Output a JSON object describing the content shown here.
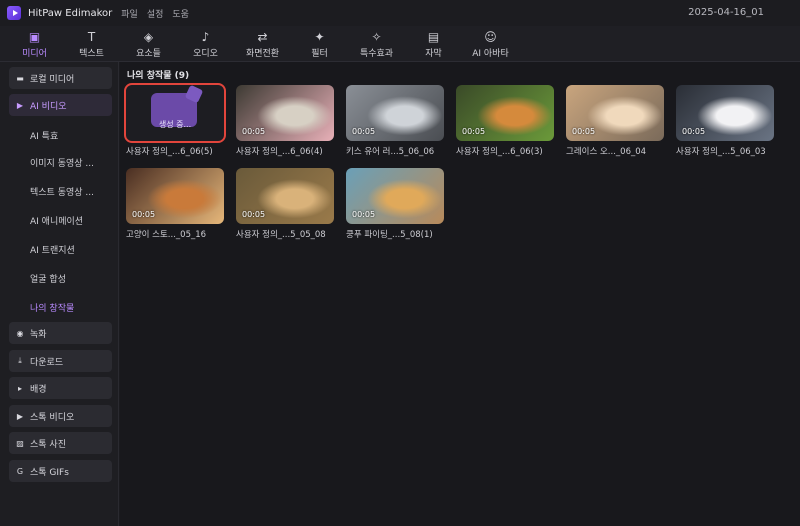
{
  "app": {
    "name": "HitPaw Edimakor",
    "menu": [
      "파일",
      "설정",
      "도움"
    ],
    "project_name": "2025-04-16_01",
    "accent": "#b98bff"
  },
  "toolbar": {
    "tabs": [
      {
        "label": "미디어",
        "icon": "media-icon",
        "glyph": "▣",
        "active": true
      },
      {
        "label": "텍스트",
        "icon": "text-icon",
        "glyph": "T",
        "active": false
      },
      {
        "label": "요소들",
        "icon": "elements-icon",
        "glyph": "◈",
        "active": false
      },
      {
        "label": "오디오",
        "icon": "audio-icon",
        "glyph": "♪",
        "active": false
      },
      {
        "label": "화면전환",
        "icon": "transition-icon",
        "glyph": "⇄",
        "active": false
      },
      {
        "label": "필터",
        "icon": "filter-icon",
        "glyph": "✦",
        "active": false
      },
      {
        "label": "특수효과",
        "icon": "effects-icon",
        "glyph": "✧",
        "active": false
      },
      {
        "label": "자막",
        "icon": "subtitle-icon",
        "glyph": "▤",
        "active": false
      },
      {
        "label": "AI 아바타",
        "icon": "avatar-icon",
        "glyph": "☺",
        "active": false
      }
    ]
  },
  "sidebar": {
    "items": [
      {
        "label": "로컬 미디어",
        "icon": "folder-icon",
        "glyph": "▬"
      },
      {
        "label": "AI 비디오",
        "icon": "ai-video-icon",
        "glyph": "▶",
        "selected": true
      },
      {
        "label": "녹화",
        "icon": "record-icon",
        "glyph": "◉"
      },
      {
        "label": "다운로드",
        "icon": "download-icon",
        "glyph": "⤓"
      },
      {
        "label": "배경",
        "icon": "expand-arrow-icon",
        "glyph": "▸"
      },
      {
        "label": "스톡 비디오",
        "icon": "stock-video-icon",
        "glyph": "▶"
      },
      {
        "label": "스톡 사진",
        "icon": "stock-photo-icon",
        "glyph": "▨"
      },
      {
        "label": "스톡 GIFs",
        "icon": "gif-icon",
        "glyph": "G"
      }
    ],
    "subitems": [
      {
        "label": "AI 특효",
        "selected": false
      },
      {
        "label": "이미지 동영상 ...",
        "selected": false
      },
      {
        "label": "텍스트 동영상 ...",
        "selected": false
      },
      {
        "label": "AI 애니메이션",
        "selected": false
      },
      {
        "label": "AI 트랜지션",
        "selected": false
      },
      {
        "label": "얼굴 합성",
        "selected": false
      },
      {
        "label": "나의 창작물",
        "selected": true
      }
    ]
  },
  "content": {
    "title": "나의 창작물 (9)",
    "items": [
      {
        "caption": "사용자 정의_...6_06(5)",
        "duration": "",
        "status": "생성 중...",
        "generating": true,
        "selected": true
      },
      {
        "caption": "사용자 정의_...6_06(4)",
        "duration": "00:05",
        "palette": [
          "#3d3a33",
          "#d7d0c4",
          "#e8b0b8"
        ]
      },
      {
        "caption": "키스 유어 러...5_06_06",
        "duration": "00:05",
        "palette": [
          "#8a8f96",
          "#cfd3d8",
          "#4a4d52"
        ]
      },
      {
        "caption": "사용자 정의_...6_06(3)",
        "duration": "00:05",
        "palette": [
          "#3a4a28",
          "#d58a3c",
          "#6b9a3a"
        ]
      },
      {
        "caption": "그레이스 오..._06_04",
        "duration": "00:05",
        "palette": [
          "#c9a57e",
          "#f0d9bc",
          "#7a6a5a"
        ]
      },
      {
        "caption": "사용자 정의_...5_06_03",
        "duration": "00:05",
        "palette": [
          "#2a2e36",
          "#f2f2f4",
          "#6a7484"
        ]
      },
      {
        "caption": "고양이 스토..._05_16",
        "duration": "00:05",
        "palette": [
          "#4a2e22",
          "#c97a3a",
          "#e6b77a"
        ]
      },
      {
        "caption": "사용자 정의_...5_05_08",
        "duration": "00:05",
        "palette": [
          "#6a5a3a",
          "#d9b27a",
          "#9a7a4a"
        ]
      },
      {
        "caption": "쿵푸 파이팅_...5_08(1)",
        "duration": "00:05",
        "palette": [
          "#6aa0b8",
          "#e0a95a",
          "#b88a5a"
        ]
      }
    ]
  }
}
